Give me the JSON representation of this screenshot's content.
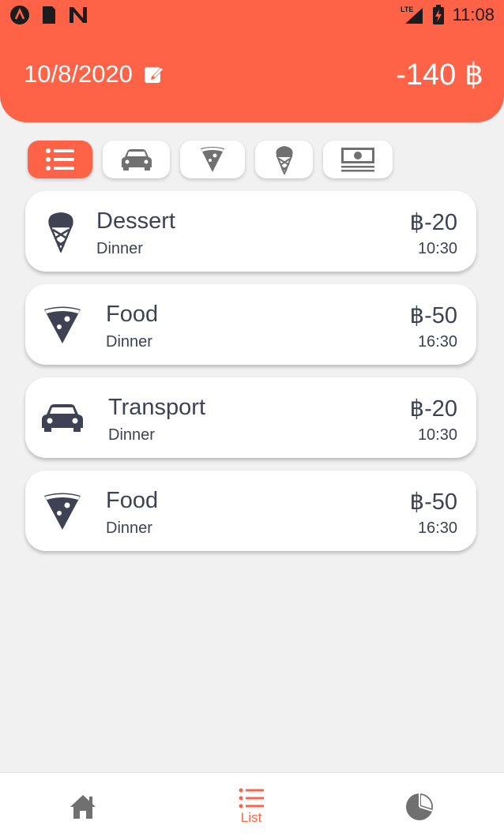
{
  "status_bar": {
    "time": "11:08",
    "network": "LTE",
    "icons_left": [
      "app-a-icon",
      "sd-card-icon",
      "n-icon"
    ],
    "icons_right": [
      "signal-icon",
      "battery-charging-icon"
    ]
  },
  "header": {
    "date": "10/8/2020",
    "edit_icon": "edit-icon",
    "total": "-140 ฿"
  },
  "filters": [
    {
      "icon": "list-icon",
      "active": true
    },
    {
      "icon": "car-icon",
      "active": false
    },
    {
      "icon": "pizza-icon",
      "active": false
    },
    {
      "icon": "ice-cream-icon",
      "active": false
    },
    {
      "icon": "money-icon",
      "active": false
    }
  ],
  "transactions": [
    {
      "icon": "ice-cream-icon",
      "category": "Dessert",
      "note": "Dinner",
      "amount": "฿-20",
      "time": "10:30"
    },
    {
      "icon": "pizza-icon",
      "category": "Food",
      "note": "Dinner",
      "amount": "฿-50",
      "time": "16:30"
    },
    {
      "icon": "car-icon",
      "category": "Transport",
      "note": "Dinner",
      "amount": "฿-20",
      "time": "10:30"
    },
    {
      "icon": "pizza-icon",
      "category": "Food",
      "note": "Dinner",
      "amount": "฿-50",
      "time": "16:30"
    }
  ],
  "bottom_nav": {
    "home_icon": "home-icon",
    "list_label": "List",
    "chart_icon": "pie-chart-icon"
  },
  "colors": {
    "accent": "#ff6347",
    "text": "#3e4252",
    "background": "#f1f1f1"
  }
}
